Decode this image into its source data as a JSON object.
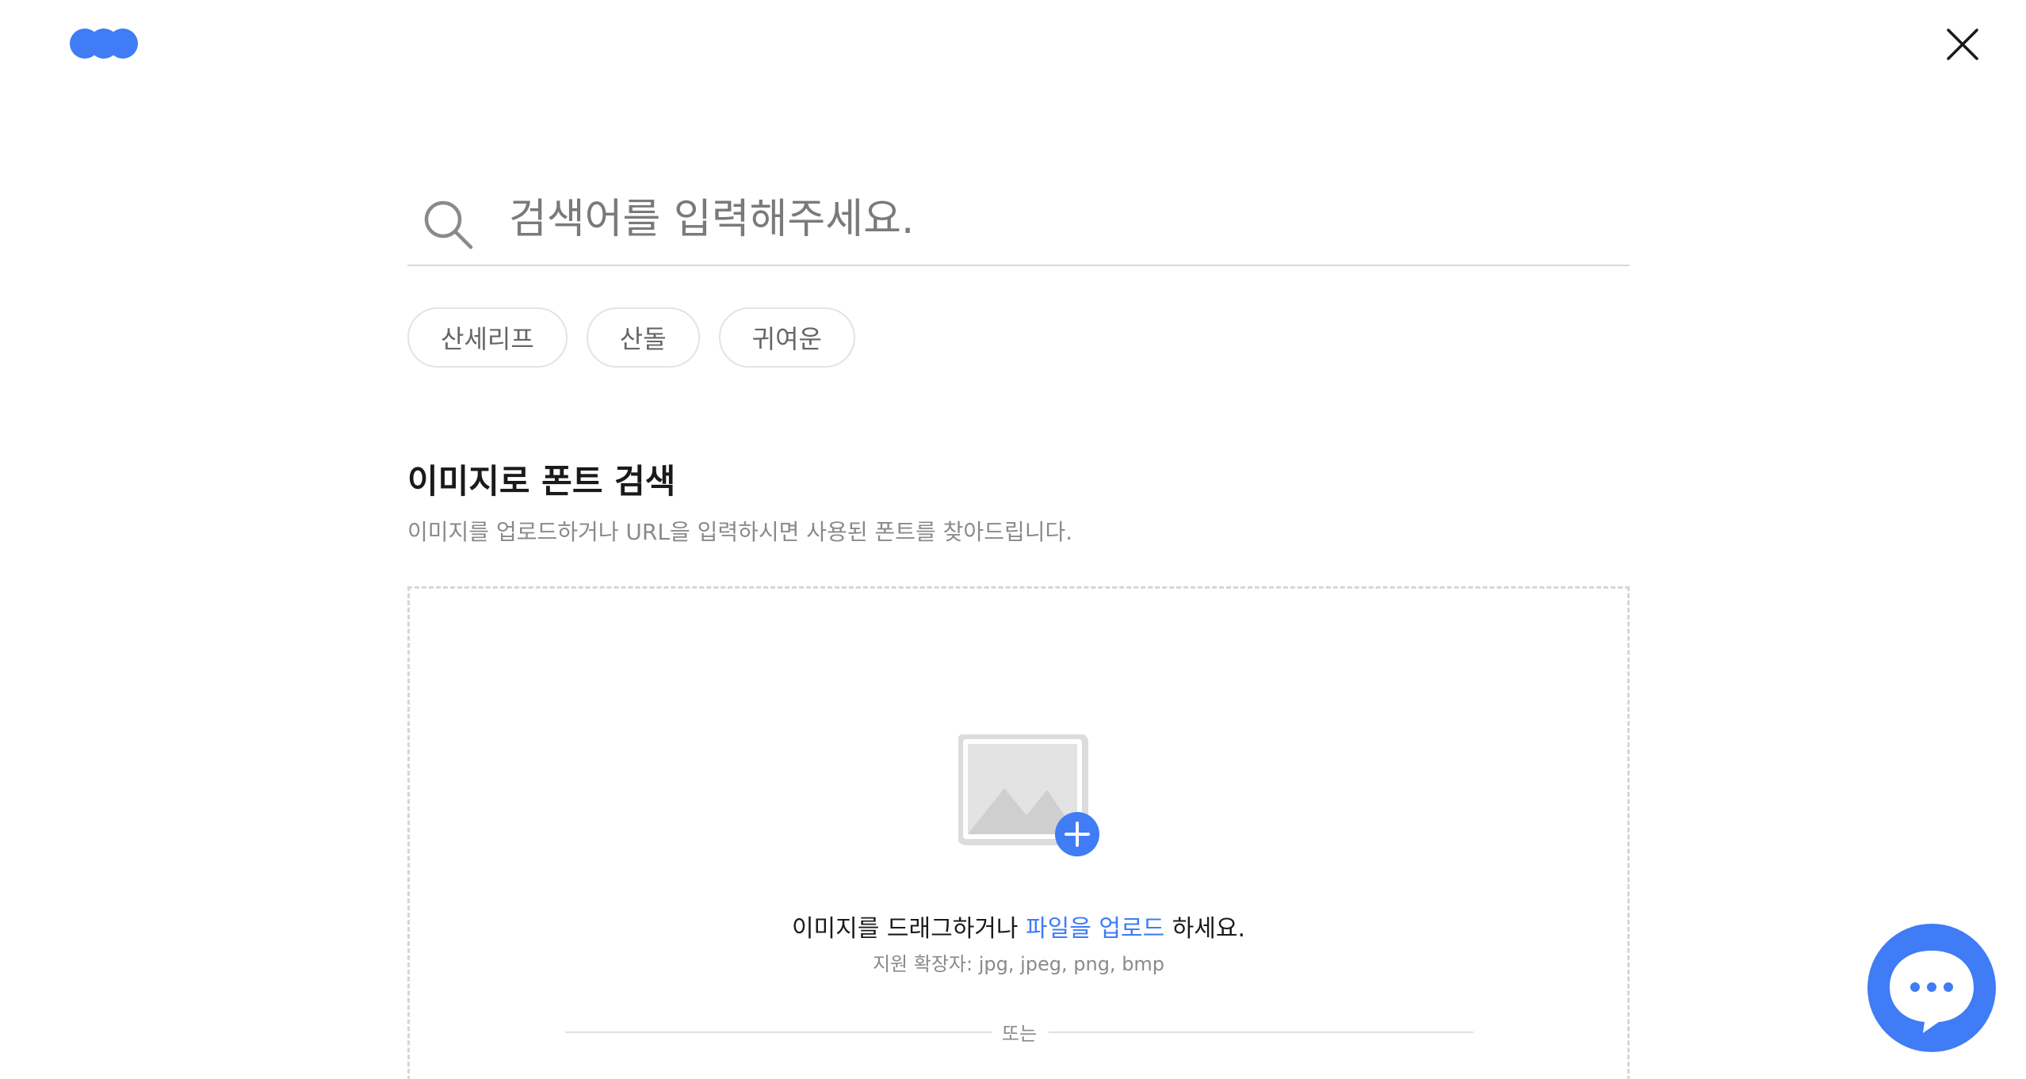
{
  "app": {
    "logo_icon": "three-dots-logo",
    "close_icon": "close-icon",
    "accent_color": "#3f7cf5"
  },
  "search": {
    "placeholder": "검색어를 입력해주세요.",
    "icon": "search-icon"
  },
  "chips": [
    {
      "label": "산세리프"
    },
    {
      "label": "산돌"
    },
    {
      "label": "귀여운"
    }
  ],
  "image_search": {
    "title": "이미지로 폰트 검색",
    "description": "이미지를 업로드하거나 URL을 입력하시면 사용된 폰트를 찾아드립니다.",
    "drop_text_before": "이미지를 드래그하거나 ",
    "drop_link": "파일을 업로드",
    "drop_text_after": " 하세요.",
    "extensions": "지원 확장자: jpg, jpeg, png, bmp",
    "or_label": "또는",
    "upload_icon": "image-add-icon"
  },
  "chat": {
    "icon": "chat-bubble-icon"
  }
}
